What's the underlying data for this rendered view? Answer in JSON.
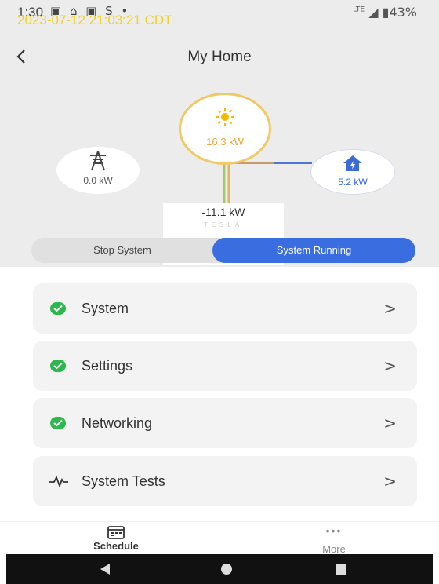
{
  "status_bar": {
    "time": "1:30",
    "notification_icons": [
      "linkedin-icon",
      "cloud-icon",
      "linkedin-icon",
      "s-icon",
      "dot-icon"
    ],
    "network": "LTE",
    "battery": "43%"
  },
  "overlay": {
    "timestamp": "2023-07-12 21:03:21 CDT"
  },
  "header": {
    "title": "My Home"
  },
  "energy_flow": {
    "solar": {
      "value": "16.3 kW",
      "icon": "sun-icon",
      "color": "#f5b800"
    },
    "grid": {
      "value": "0.0 kW",
      "icon": "power-tower-icon"
    },
    "home": {
      "value": "5.2 kW",
      "icon": "home-bolt-icon",
      "color": "#3a6bd8"
    },
    "battery": {
      "value": "-11.1 kW",
      "brand": "TESLA"
    }
  },
  "system_toggle": {
    "stop_label": "Stop System",
    "running_label": "System Running",
    "active": "running",
    "accent": "#3a6ee0"
  },
  "menu": {
    "items": [
      {
        "label": "System",
        "status_icon": "check-circle-icon"
      },
      {
        "label": "Settings",
        "status_icon": "check-circle-icon"
      },
      {
        "label": "Networking",
        "status_icon": "check-circle-icon"
      },
      {
        "label": "System Tests",
        "status_icon": "pulse-icon"
      }
    ],
    "chevron": ">",
    "status_color": "#2db84d"
  },
  "tab_bar": {
    "schedule_label": "Schedule",
    "more_label": "More",
    "more_icon": "•••"
  }
}
